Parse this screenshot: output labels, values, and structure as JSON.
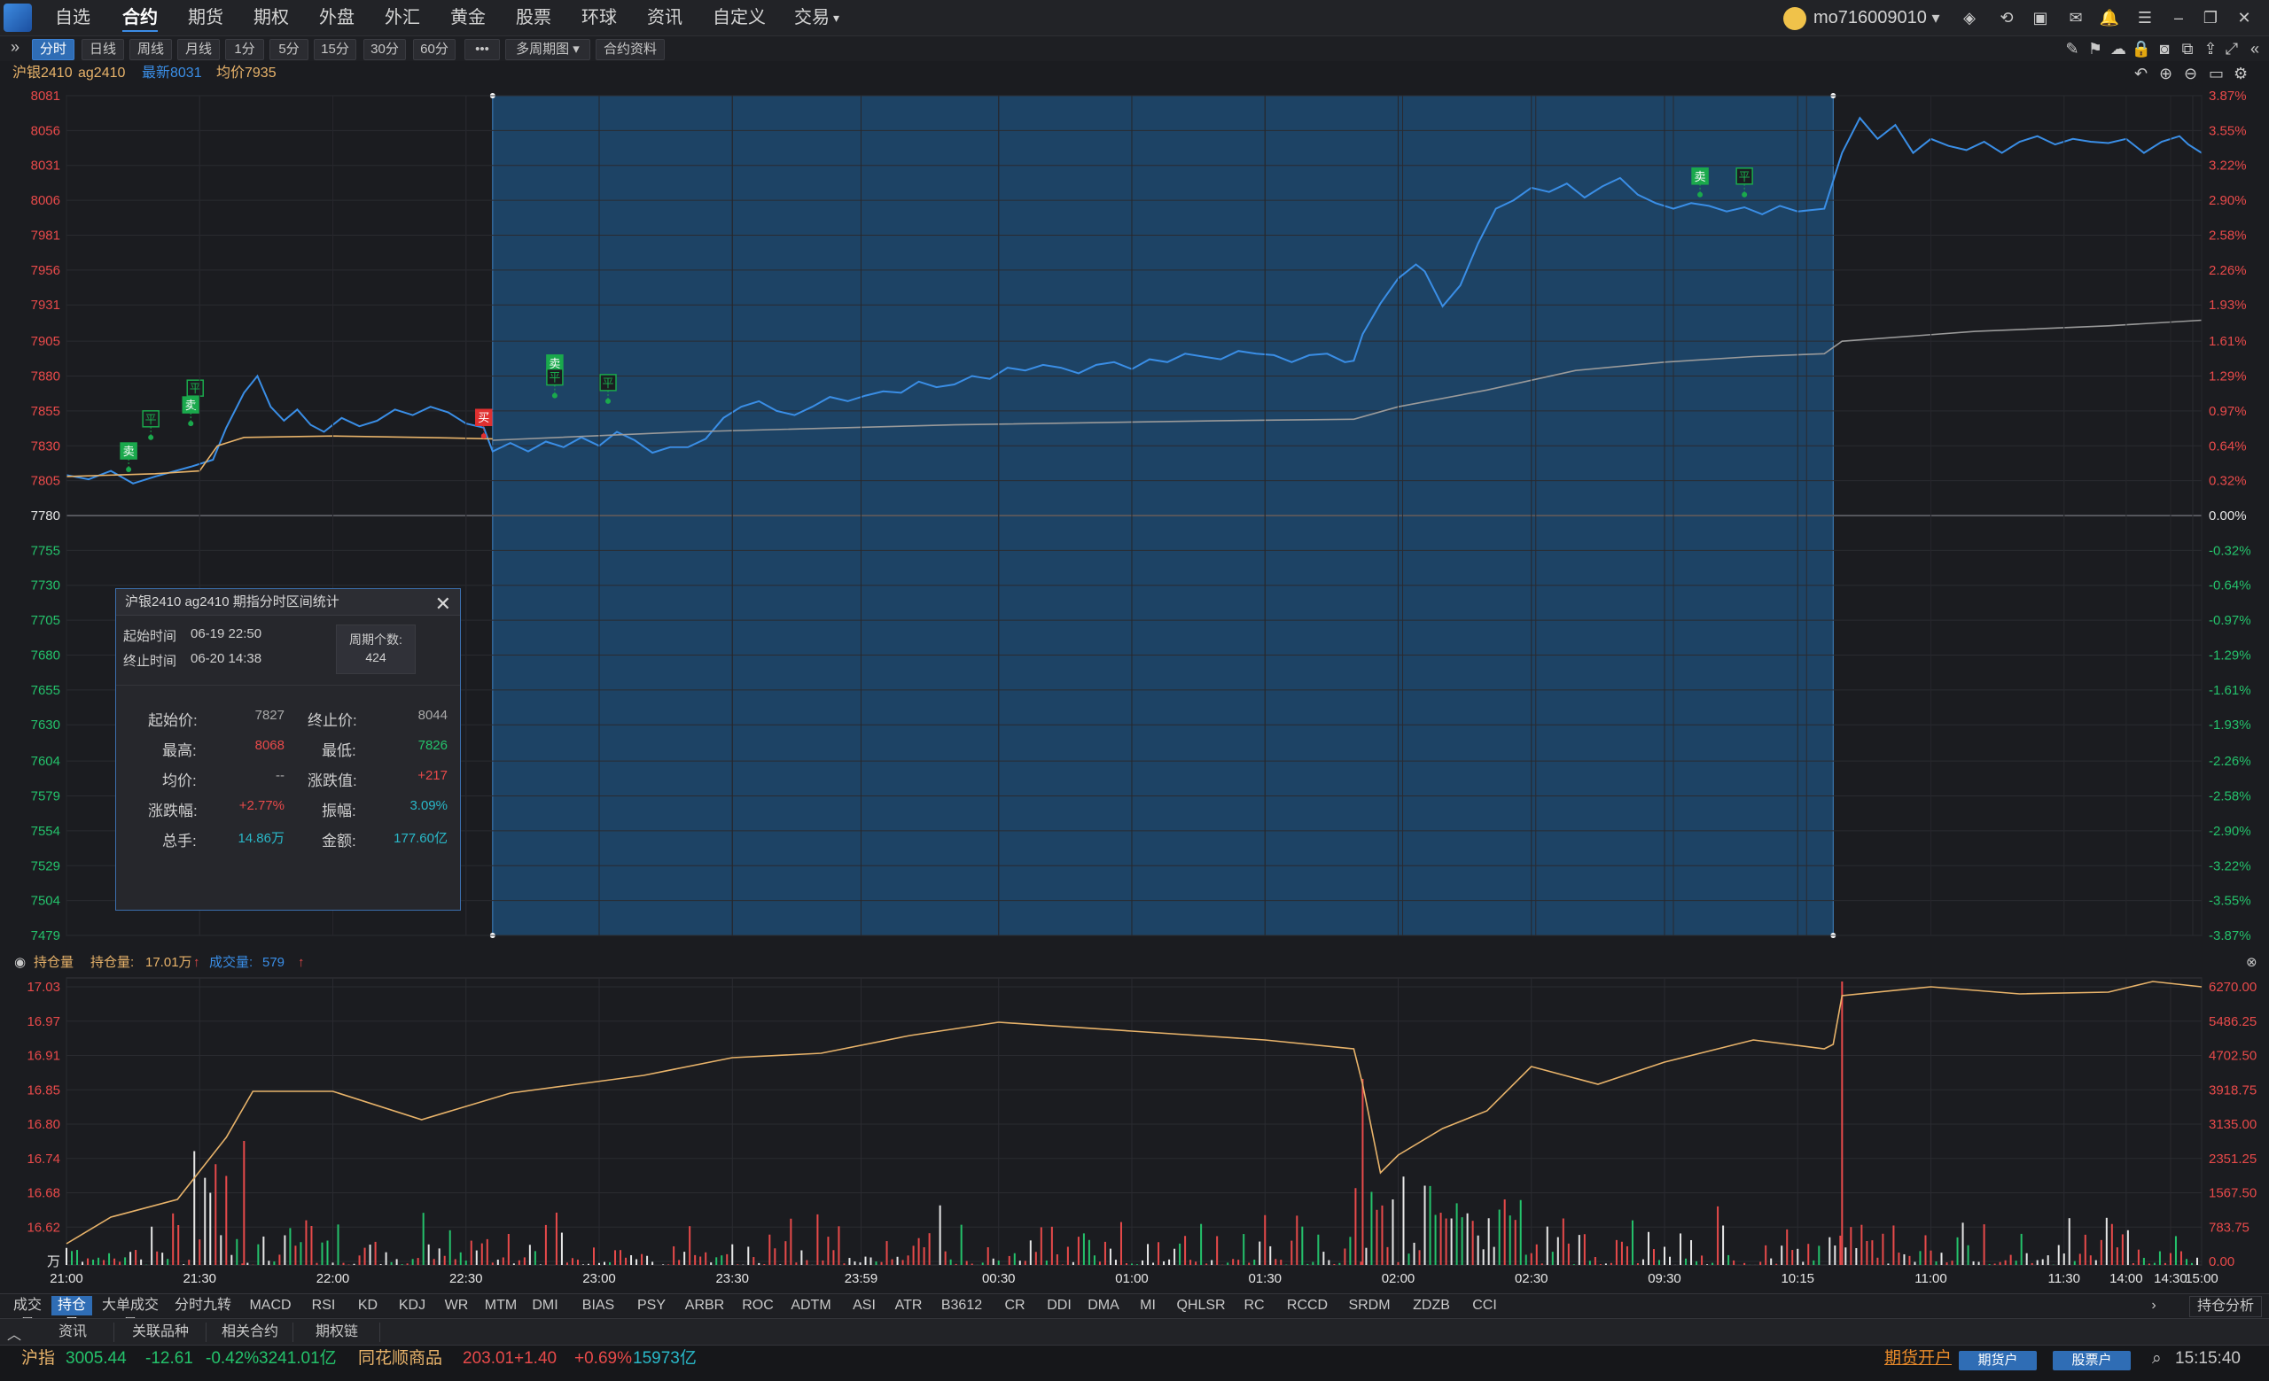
{
  "menu": {
    "items": [
      "自选",
      "合约",
      "期货",
      "期权",
      "外盘",
      "外汇",
      "黄金",
      "股票",
      "环球",
      "资讯",
      "自定义",
      "交易"
    ],
    "active_index": 1,
    "username": "mo716009010"
  },
  "toolbar": {
    "buttons": [
      "分时",
      "日线",
      "周线",
      "月线",
      "1分",
      "5分",
      "15分",
      "30分",
      "60分",
      "•••",
      "多周期图 ▾",
      "合约资料"
    ],
    "active_index": 0
  },
  "info": {
    "name": "沪银2410",
    "code": "ag2410",
    "latest": "最新8031",
    "avg": "均价7935"
  },
  "chart_data": [
    {
      "type": "line",
      "title": "沪银2410 ag2410 分时",
      "x_ticks": [
        "21:00",
        "21:30",
        "22:00",
        "22:30",
        "23:00",
        "23:30",
        "23:59",
        "00:30",
        "01:00",
        "01:30",
        "02:00",
        "02:30",
        "09:30",
        "10:15",
        "11:00",
        "11:30",
        "14:00",
        "14:30",
        "15:00"
      ],
      "y_ticks_left": [
        "8081",
        "8056",
        "8031",
        "8006",
        "7981",
        "7956",
        "7931",
        "7905",
        "7880",
        "7855",
        "7830",
        "7805",
        "7780",
        "7755",
        "7730",
        "7705",
        "7680",
        "7655",
        "7630",
        "7604",
        "7579",
        "7554",
        "7529",
        "7504",
        "7479"
      ],
      "y_ticks_right": [
        "3.87%",
        "3.55%",
        "3.22%",
        "2.90%",
        "2.58%",
        "2.26%",
        "1.93%",
        "1.61%",
        "1.29%",
        "0.97%",
        "0.64%",
        "0.32%",
        "0.00%",
        "-0.32%",
        "-0.64%",
        "-0.97%",
        "-1.29%",
        "-1.61%",
        "-1.93%",
        "-2.26%",
        "-2.58%",
        "-2.90%",
        "-3.22%",
        "-3.55%",
        "-3.87%"
      ],
      "ylim": [
        7479,
        8081
      ],
      "prev_close": 7780,
      "series": [
        {
          "name": "最新",
          "color": "#3a8ee6",
          "points": [
            [
              0,
              7809
            ],
            [
              5,
              7806
            ],
            [
              10,
              7812
            ],
            [
              15,
              7803
            ],
            [
              20,
              7808
            ],
            [
              28,
              7815
            ],
            [
              33,
              7820
            ],
            [
              36,
              7843
            ],
            [
              40,
              7868
            ],
            [
              43,
              7880
            ],
            [
              46,
              7858
            ],
            [
              49,
              7848
            ],
            [
              52,
              7856
            ],
            [
              55,
              7845
            ],
            [
              58,
              7840
            ],
            [
              62,
              7850
            ],
            [
              66,
              7844
            ],
            [
              70,
              7848
            ],
            [
              74,
              7856
            ],
            [
              78,
              7852
            ],
            [
              82,
              7858
            ],
            [
              86,
              7854
            ],
            [
              90,
              7846
            ],
            [
              94,
              7843
            ],
            [
              96,
              7826
            ],
            [
              100,
              7832
            ],
            [
              104,
              7826
            ],
            [
              108,
              7833
            ],
            [
              112,
              7829
            ],
            [
              116,
              7836
            ],
            [
              120,
              7830
            ],
            [
              124,
              7840
            ],
            [
              128,
              7834
            ],
            [
              132,
              7825
            ],
            [
              136,
              7829
            ],
            [
              140,
              7829
            ],
            [
              144,
              7835
            ],
            [
              148,
              7850
            ],
            [
              152,
              7858
            ],
            [
              156,
              7862
            ],
            [
              160,
              7855
            ],
            [
              164,
              7852
            ],
            [
              168,
              7858
            ],
            [
              172,
              7865
            ],
            [
              176,
              7862
            ],
            [
              180,
              7866
            ],
            [
              184,
              7869
            ],
            [
              188,
              7868
            ],
            [
              192,
              7876
            ],
            [
              196,
              7872
            ],
            [
              200,
              7874
            ],
            [
              204,
              7880
            ],
            [
              208,
              7878
            ],
            [
              212,
              7886
            ],
            [
              216,
              7884
            ],
            [
              220,
              7888
            ],
            [
              224,
              7886
            ],
            [
              228,
              7882
            ],
            [
              232,
              7888
            ],
            [
              236,
              7890
            ],
            [
              240,
              7885
            ],
            [
              244,
              7892
            ],
            [
              248,
              7890
            ],
            [
              252,
              7896
            ],
            [
              256,
              7894
            ],
            [
              260,
              7892
            ],
            [
              264,
              7898
            ],
            [
              268,
              7896
            ],
            [
              272,
              7895
            ],
            [
              276,
              7890
            ],
            [
              280,
              7895
            ],
            [
              284,
              7896
            ],
            [
              288,
              7890
            ],
            [
              290,
              7891
            ],
            [
              292,
              7910
            ],
            [
              296,
              7932
            ],
            [
              300,
              7950
            ],
            [
              304,
              7960
            ],
            [
              306,
              7955
            ],
            [
              310,
              7930
            ],
            [
              314,
              7945
            ],
            [
              318,
              7975
            ],
            [
              322,
              8000
            ],
            [
              326,
              8006
            ],
            [
              330,
              8015
            ],
            [
              334,
              8012
            ],
            [
              338,
              8018
            ],
            [
              342,
              8008
            ],
            [
              346,
              8016
            ],
            [
              350,
              8022
            ],
            [
              354,
              8010
            ],
            [
              358,
              8004
            ],
            [
              362,
              8000
            ],
            [
              366,
              8004
            ],
            [
              370,
              8002
            ],
            [
              374,
              7998
            ],
            [
              378,
              8001
            ],
            [
              382,
              7996
            ],
            [
              386,
              8002
            ],
            [
              390,
              7998
            ],
            [
              396,
              8000
            ],
            [
              400,
              8040
            ],
            [
              404,
              8065
            ],
            [
              408,
              8050
            ],
            [
              412,
              8060
            ],
            [
              416,
              8040
            ],
            [
              420,
              8050
            ],
            [
              424,
              8045
            ],
            [
              428,
              8042
            ],
            [
              432,
              8048
            ],
            [
              436,
              8040
            ],
            [
              440,
              8048
            ],
            [
              444,
              8052
            ],
            [
              448,
              8046
            ],
            [
              452,
              8050
            ],
            [
              456,
              8048
            ],
            [
              460,
              8047
            ],
            [
              464,
              8050
            ],
            [
              468,
              8040
            ],
            [
              472,
              8048
            ],
            [
              476,
              8052
            ],
            [
              478,
              8046
            ],
            [
              481,
              8040
            ]
          ]
        },
        {
          "name": "均价",
          "color": "#e8b36a",
          "points": [
            [
              0,
              7808
            ],
            [
              20,
              7810
            ],
            [
              30,
              7812
            ],
            [
              34,
              7830
            ],
            [
              40,
              7836
            ],
            [
              60,
              7837
            ],
            [
              80,
              7836
            ],
            [
              96,
              7835
            ]
          ]
        },
        {
          "name": "均价",
          "color": "#9a9a9a",
          "points": [
            [
              96,
              7834
            ],
            [
              140,
              7840
            ],
            [
              200,
              7845
            ],
            [
              260,
              7848
            ],
            [
              290,
              7849
            ],
            [
              300,
              7858
            ],
            [
              320,
              7870
            ],
            [
              340,
              7884
            ],
            [
              360,
              7890
            ],
            [
              380,
              7894
            ],
            [
              396,
              7896
            ],
            [
              400,
              7905
            ],
            [
              430,
              7912
            ],
            [
              460,
              7916
            ],
            [
              481,
              7920
            ]
          ]
        }
      ]
    },
    {
      "type": "bar",
      "title": "持仓量 / 成交量",
      "y_ticks_left": [
        "17.03",
        "16.97",
        "16.91",
        "16.85",
        "16.80",
        "16.74",
        "16.68",
        "16.62",
        "万"
      ],
      "y_ticks_right": [
        "6270.00",
        "5486.25",
        "4702.50",
        "3918.75",
        "3135.00",
        "2351.25",
        "1567.50",
        "783.75",
        "0.00"
      ]
    }
  ],
  "markers": [
    {
      "label": "卖",
      "type": "sell"
    },
    {
      "label": "平",
      "type": "close"
    },
    {
      "label": "卖",
      "type": "sell"
    },
    {
      "label": "平",
      "type": "close"
    },
    {
      "label": "买",
      "type": "buy"
    },
    {
      "label": "卖",
      "type": "sell"
    },
    {
      "label": "平",
      "type": "close"
    },
    {
      "label": "平",
      "type": "close"
    },
    {
      "label": "卖",
      "type": "sell"
    },
    {
      "label": "平",
      "type": "close"
    }
  ],
  "popup": {
    "title": "沪银2410  ag2410  期指分时区间统计",
    "start_time_label": "起始时间",
    "start_time": "06-19 22:50",
    "end_time_label": "终止时间",
    "end_time": "06-20 14:38",
    "period_label": "周期个数:",
    "period_count": "424",
    "rows": [
      {
        "l1": "起始价:",
        "v1": "7827",
        "l2": "终止价:",
        "v2": "8044"
      },
      {
        "l1": "最高:",
        "v1": "8068",
        "l2": "最低:",
        "v2": "7826"
      },
      {
        "l1": "均价:",
        "v1": "--",
        "l2": "涨跌值:",
        "v2": "+217"
      },
      {
        "l1": "涨跌幅:",
        "v1": "+2.77%",
        "l2": "振幅:",
        "v2": "3.09%"
      },
      {
        "l1": "总手:",
        "v1": "14.86万",
        "l2": "金额:",
        "v2": "177.60亿"
      }
    ]
  },
  "sub_header": {
    "title": "持仓量",
    "oi_label": "持仓量:",
    "oi_value": "17.01万",
    "vol_label": "成交量:",
    "vol_value": "579"
  },
  "indicators": [
    "成交量",
    "持仓量",
    "大单成交量",
    "分时九转",
    "MACD",
    "RSI",
    "KD",
    "KDJ",
    "WR",
    "MTM",
    "DMI",
    "BIAS",
    "PSY",
    "ARBR",
    "ROC",
    "ADTM",
    "ASI",
    "ATR",
    "B3612",
    "CR",
    "DDI",
    "DMA",
    "MI",
    "QHLSR",
    "RC",
    "RCCD",
    "SRDM",
    "ZDZB",
    "CCI"
  ],
  "indicators_active": 1,
  "right_tab": "持仓分析",
  "bottom_tabs": [
    "资讯",
    "关联品种",
    "相关合约",
    "期权链"
  ],
  "status": {
    "index1_name": "沪指",
    "index1_value": "3005.44",
    "index1_change": "-12.61",
    "index1_pct": "-0.42%",
    "index1_amount": "3241.01亿",
    "index2_name": "同花顺商品",
    "index2_value": "203.01",
    "index2_change": "+1.40",
    "index2_pct": "+0.69%",
    "index2_amount": "15973亿",
    "open_account": "期货开户",
    "btn1": "期货户",
    "btn2": "股票户",
    "clock": "15:15:40"
  }
}
